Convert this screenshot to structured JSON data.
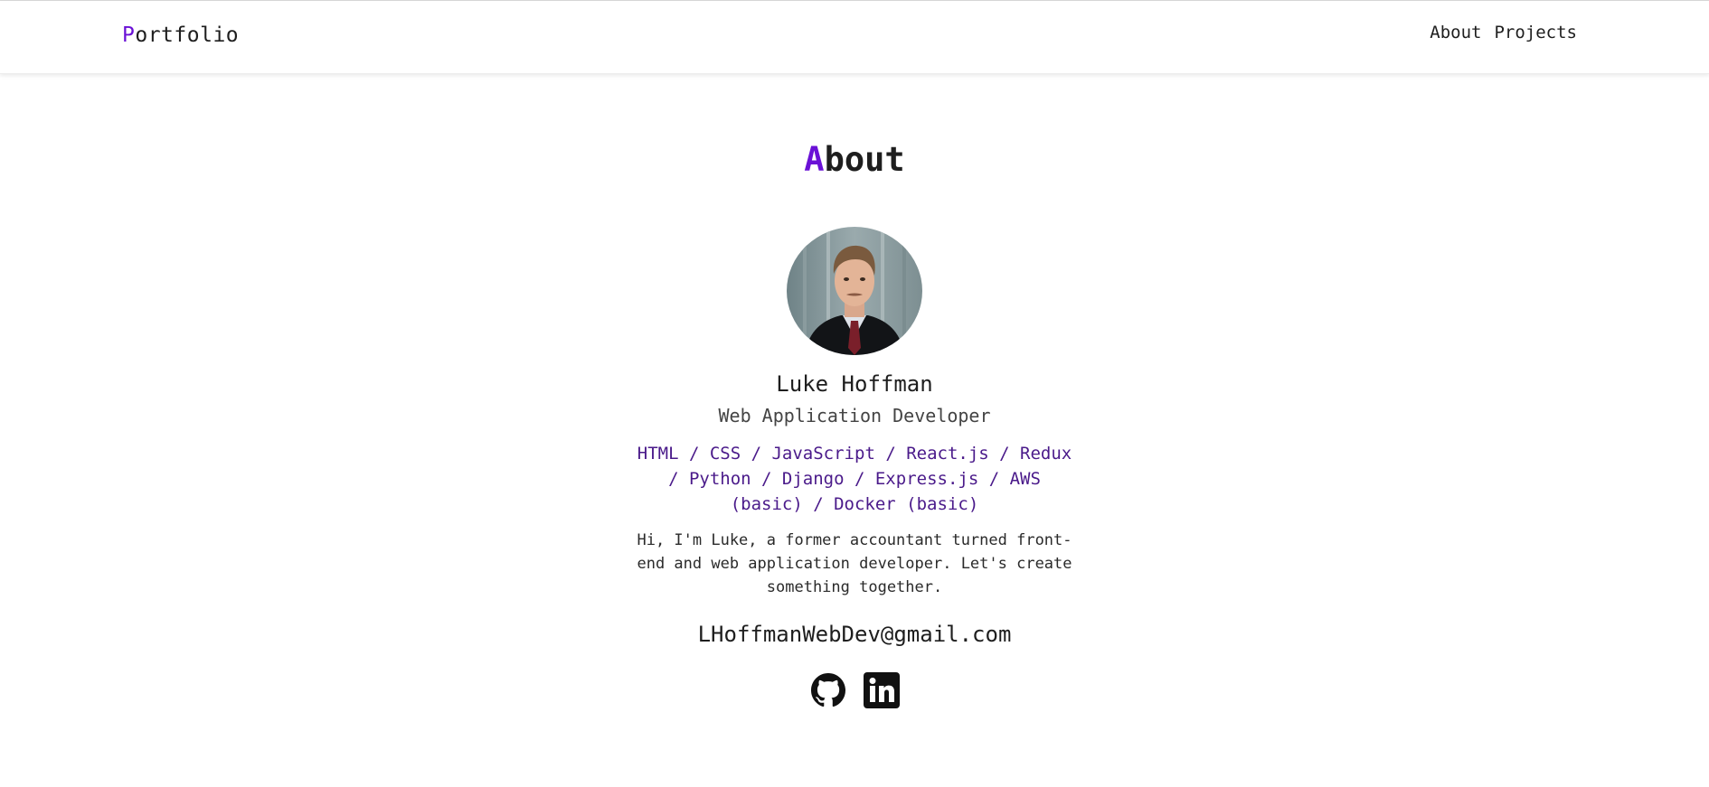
{
  "nav": {
    "brand_accent": "P",
    "brand_rest": "ortfolio",
    "links": [
      {
        "label": "About"
      },
      {
        "label": "Projects"
      }
    ]
  },
  "about": {
    "title_accent": "A",
    "title_rest": "bout",
    "name": "Luke Hoffman",
    "role": "Web Application Developer",
    "skills": "HTML / CSS / JavaScript / React.js / Redux / Python / Django / Express.js / AWS (basic) / Docker (basic)",
    "bio": "Hi, I'm Luke, a former accountant turned front-end and web application developer. Let's create something together.",
    "email": "LHoffmanWebDev@gmail.com"
  },
  "socials": [
    {
      "icon": "github-icon"
    },
    {
      "icon": "linkedin-icon"
    }
  ],
  "colors": {
    "accent": "#6a11d6",
    "skills_text": "#4a1a8a",
    "text": "#1e1e1e"
  }
}
